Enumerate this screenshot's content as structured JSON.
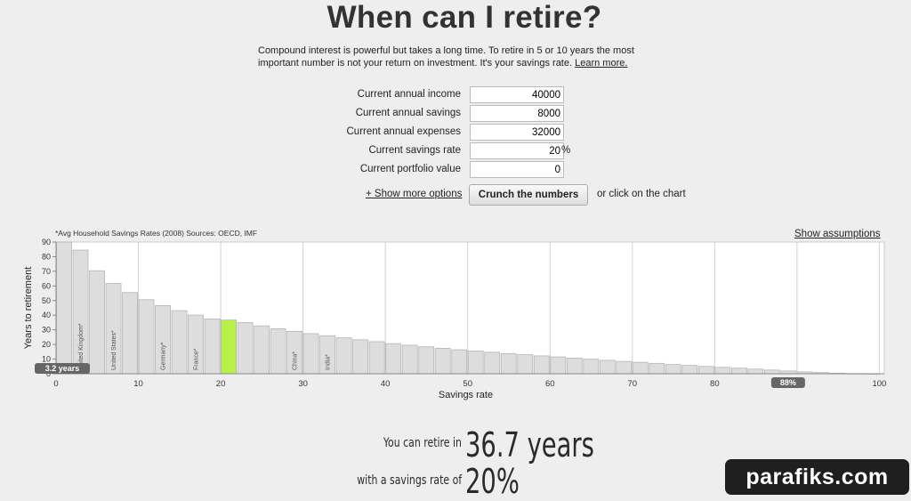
{
  "page": {
    "title": "When can I retire?",
    "intro": "Compound interest is powerful but takes a long time. To retire in 5 or 10 years the most important number is not your return on investment. It's your savings rate.",
    "learn_more": "Learn more."
  },
  "form": {
    "fields": [
      {
        "label": "Current annual income",
        "value": "40000"
      },
      {
        "label": "Current annual savings",
        "value": "8000"
      },
      {
        "label": "Current annual expenses",
        "value": "32000"
      },
      {
        "label": "Current savings rate",
        "value": "20",
        "unit": "%"
      },
      {
        "label": "Current portfolio value",
        "value": "0"
      }
    ],
    "show_more": "+ Show more options",
    "crunch": "Crunch the numbers",
    "click_hint": "or click on the chart"
  },
  "chart_meta": {
    "source_note": "*Avg Household Savings Rates (2008) Sources: OECD, IMF",
    "show_assumptions": "Show assumptions"
  },
  "chart_data": {
    "type": "bar",
    "xlabel": "Savings rate",
    "ylabel": "Years to retirement",
    "xlim": [
      0,
      100
    ],
    "ylim": [
      0,
      90
    ],
    "x_ticks": [
      0,
      10,
      20,
      30,
      40,
      50,
      60,
      70,
      80,
      90,
      100
    ],
    "x_tick_labels": [
      "0",
      "10",
      "20",
      "30",
      "40",
      "50",
      "60",
      "70",
      "80",
      "",
      "100"
    ],
    "y_ticks": [
      0,
      10,
      20,
      30,
      40,
      50,
      60,
      70,
      80,
      90
    ],
    "bar_step": 2,
    "x": [
      0,
      2,
      4,
      6,
      8,
      10,
      12,
      14,
      16,
      18,
      20,
      22,
      24,
      26,
      28,
      30,
      32,
      34,
      36,
      38,
      40,
      42,
      44,
      46,
      48,
      50,
      52,
      54,
      56,
      58,
      60,
      62,
      64,
      66,
      68,
      70,
      72,
      74,
      76,
      78,
      80,
      82,
      84,
      86,
      88,
      90,
      92,
      94,
      96,
      98
    ],
    "values": [
      90,
      84.5,
      70.4,
      61.7,
      55.5,
      50.6,
      46.6,
      43.1,
      40.1,
      37.5,
      36.7,
      34.9,
      32.7,
      30.7,
      29.0,
      27.4,
      26.0,
      24.6,
      23.2,
      21.9,
      20.6,
      19.5,
      18.4,
      17.4,
      16.4,
      15.5,
      14.7,
      13.8,
      13.0,
      12.2,
      11.5,
      10.7,
      10.0,
      9.2,
      8.4,
      7.8,
      7.1,
      6.3,
      5.7,
      5.0,
      4.4,
      3.8,
      3.2,
      2.5,
      1.9,
      1.3,
      0.8,
      0.4,
      0.1,
      0.0
    ],
    "highlight_x": 20,
    "highlight_color": "#b8f04a",
    "bar_color": "#dddddd",
    "country_labels": [
      {
        "x": 2,
        "label": "United Kingdom*"
      },
      {
        "x": 6,
        "label": "United States*"
      },
      {
        "x": 12,
        "label": "Germany*"
      },
      {
        "x": 16,
        "label": "France*"
      },
      {
        "x": 28,
        "label": "China*"
      },
      {
        "x": 32,
        "label": "India*"
      }
    ],
    "markers": [
      {
        "x": 0,
        "label": "3.2 years",
        "position": "y-axis"
      },
      {
        "x": 88,
        "label": "88%",
        "position": "x-axis"
      }
    ],
    "grid": true
  },
  "result": {
    "line1_prefix": "You can retire in",
    "line1_value": "36.7 years",
    "line2_prefix": "with a savings rate of",
    "line2_value": "20%"
  },
  "watermark": "parafiks.com"
}
